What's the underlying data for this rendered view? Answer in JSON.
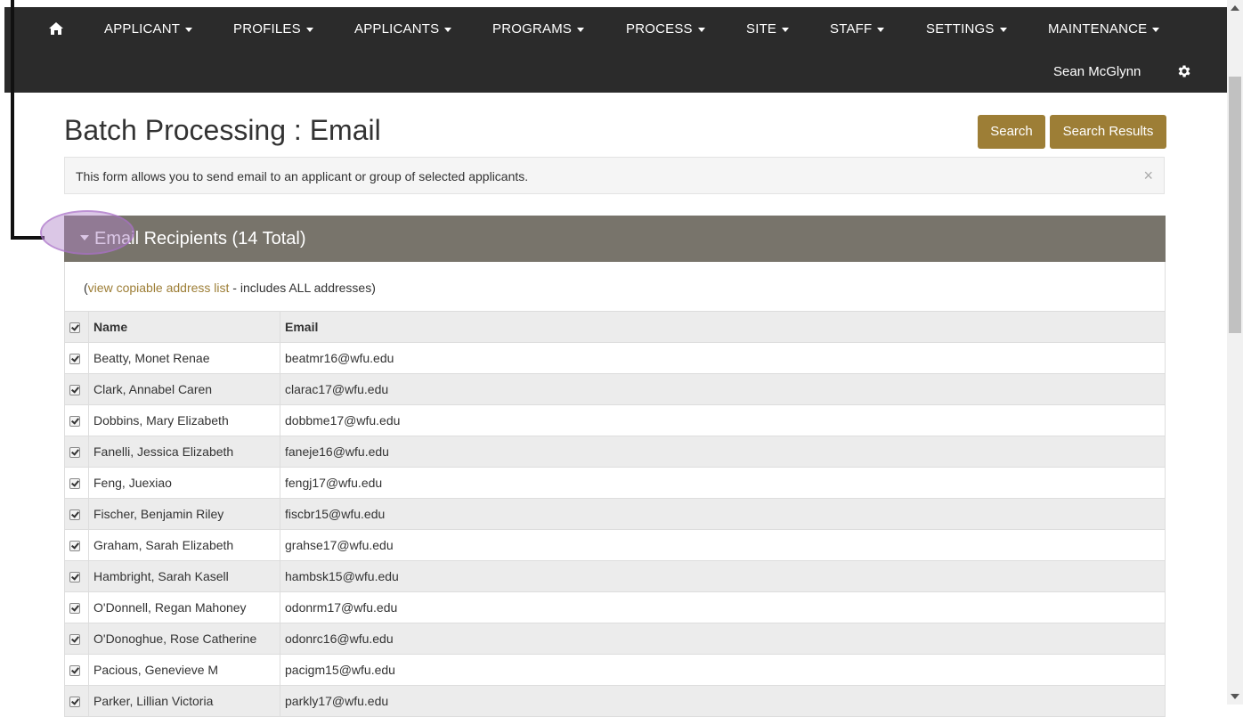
{
  "nav": {
    "items": [
      {
        "label": "APPLICANT"
      },
      {
        "label": "PROFILES"
      },
      {
        "label": "APPLICANTS"
      },
      {
        "label": "PROGRAMS"
      },
      {
        "label": "PROCESS"
      },
      {
        "label": "SITE"
      },
      {
        "label": "STAFF"
      },
      {
        "label": "SETTINGS"
      },
      {
        "label": "MAINTENANCE"
      }
    ],
    "user_name": "Sean McGlynn"
  },
  "page": {
    "title": "Batch Processing : Email",
    "search_button": "Search",
    "search_results_button": "Search Results",
    "info_text": "This form allows you to send email to an applicant or group of selected applicants.",
    "info_close": "×"
  },
  "panel": {
    "title": "Email Recipients (14 Total)",
    "copy_prefix": "(",
    "copy_link": "view copiable address list",
    "copy_suffix": " - includes ALL addresses)"
  },
  "table": {
    "headers": {
      "name": "Name",
      "email": "Email"
    },
    "rows": [
      {
        "name": "Beatty, Monet Renae",
        "email": "beatmr16@wfu.edu"
      },
      {
        "name": "Clark, Annabel Caren",
        "email": "clarac17@wfu.edu"
      },
      {
        "name": "Dobbins, Mary Elizabeth",
        "email": "dobbme17@wfu.edu"
      },
      {
        "name": "Fanelli, Jessica Elizabeth",
        "email": "faneje16@wfu.edu"
      },
      {
        "name": "Feng, Juexiao",
        "email": "fengj17@wfu.edu"
      },
      {
        "name": "Fischer, Benjamin Riley",
        "email": "fiscbr15@wfu.edu"
      },
      {
        "name": "Graham, Sarah Elizabeth",
        "email": "grahse17@wfu.edu"
      },
      {
        "name": "Hambright, Sarah Kasell",
        "email": "hambsk15@wfu.edu"
      },
      {
        "name": "O'Donnell, Regan Mahoney",
        "email": "odonrm17@wfu.edu"
      },
      {
        "name": "O'Donoghue, Rose Catherine",
        "email": "odonrc16@wfu.edu"
      },
      {
        "name": "Pacious, Genevieve M",
        "email": "pacigm15@wfu.edu"
      },
      {
        "name": "Parker, Lillian Victoria",
        "email": "parkly17@wfu.edu"
      }
    ]
  },
  "colors": {
    "navbar": "#2b2b2b",
    "accent_gold": "#9d7e36",
    "panel_heading": "#78746b"
  }
}
